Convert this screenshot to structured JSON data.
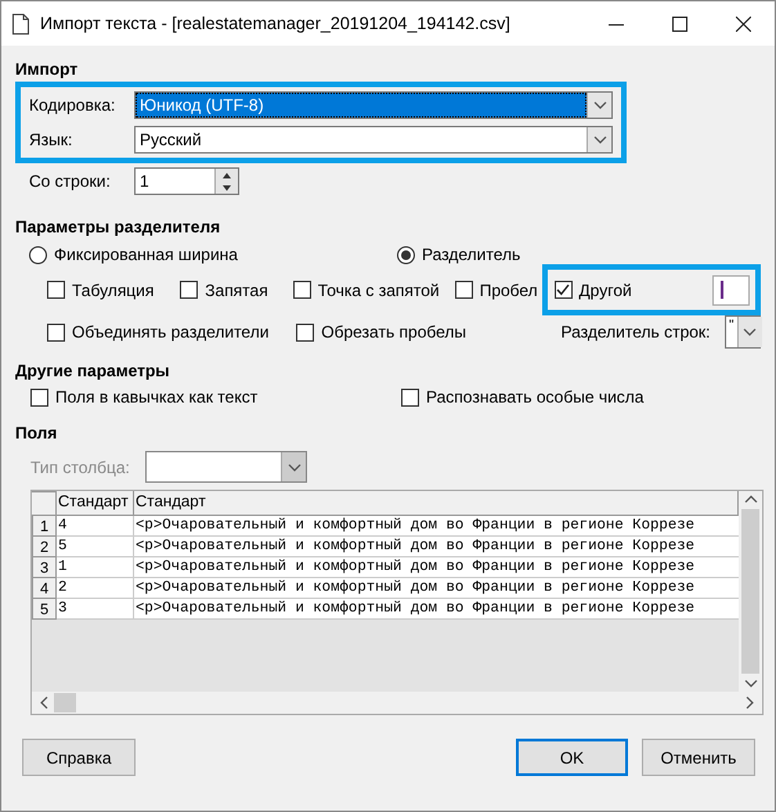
{
  "window": {
    "title": "Импорт текста - [realestatemanager_20191204_194142.csv]"
  },
  "import": {
    "heading": "Импорт",
    "encoding": {
      "label": "Кодировка:",
      "value": "Юникод (UTF-8)",
      "highlighted": true
    },
    "language": {
      "label": "Язык:",
      "value": "Русский",
      "highlighted": false
    },
    "from_row": {
      "label": "Со строки:",
      "value": "1"
    }
  },
  "separator_options": {
    "heading": "Параметры разделителя",
    "modes": [
      {
        "label": "Фиксированная ширина",
        "selected": false
      },
      {
        "label": "Разделитель",
        "selected": true
      }
    ],
    "separators": [
      {
        "label": "Табуляция",
        "checked": false
      },
      {
        "label": "Запятая",
        "checked": false
      },
      {
        "label": "Точка с запятой",
        "checked": false
      },
      {
        "label": "Пробел",
        "checked": false
      }
    ],
    "other": {
      "label": "Другой",
      "checked": true
    },
    "options": [
      {
        "label": "Объединять разделители",
        "checked": false
      },
      {
        "label": "Обрезать пробелы",
        "checked": false
      }
    ],
    "string_delimiter": {
      "label": "Разделитель строк:",
      "value": "\""
    }
  },
  "other_options": {
    "heading": "Другие параметры",
    "options": [
      {
        "label": "Поля в кавычках как текст",
        "checked": false
      },
      {
        "label": "Распознавать особые числа",
        "checked": false
      }
    ]
  },
  "fields": {
    "heading": "Поля",
    "column_type": {
      "label": "Тип столбца:",
      "disabled": true
    },
    "columns": [
      "Стандарт",
      "Стандарт"
    ],
    "rows": [
      {
        "number": "1",
        "cells": [
          "4",
          "<p>Очаровательный и комфортный дом во Франции в регионе Коррезе"
        ]
      },
      {
        "number": "2",
        "cells": [
          "5",
          "<p>Очаровательный и комфортный дом во Франции в регионе Коррезе"
        ]
      },
      {
        "number": "3",
        "cells": [
          "1",
          "<p>Очаровательный и комфортный дом во Франции в регионе Коррезе"
        ]
      },
      {
        "number": "4",
        "cells": [
          "2",
          "<p>Очаровательный и комфортный дом во Франции в регионе Коррезе"
        ]
      },
      {
        "number": "5",
        "cells": [
          "3",
          "<p>Очаровательный и комфортный дом во Франции в регионе Коррезе"
        ]
      }
    ]
  },
  "buttons": [
    {
      "label": "Справка",
      "default": false
    },
    {
      "label": "OK",
      "default": true
    },
    {
      "label": "Отменить",
      "default": false
    }
  ]
}
